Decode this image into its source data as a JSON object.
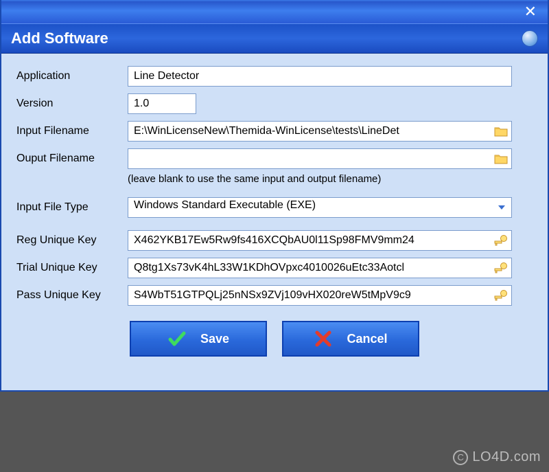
{
  "window": {
    "title": "Add Software"
  },
  "form": {
    "application": {
      "label": "Application",
      "value": "Line Detector"
    },
    "version": {
      "label": "Version",
      "value": "1.0"
    },
    "input_filename": {
      "label": "Input Filename",
      "value": "E:\\WinLicenseNew\\Themida-WinLicense\\tests\\LineDet"
    },
    "output_filename": {
      "label": "Ouput Filename",
      "value": "",
      "hint": "(leave blank to use the same input and output filename)"
    },
    "input_file_type": {
      "label": "Input File Type",
      "value": "Windows Standard Executable (EXE)"
    },
    "reg_key": {
      "label": "Reg Unique Key",
      "value": "X462YKB17Ew5Rw9fs416XCQbAU0l11Sp98FMV9mm24"
    },
    "trial_key": {
      "label": "Trial Unique Key",
      "value": "Q8tg1Xs73vK4hL33W1KDhOVpxc4010026uEtc33Aotcl"
    },
    "pass_key": {
      "label": "Pass Unique Key",
      "value": "S4WbT51GTPQLj25nNSx9ZVj109vHX020reW5tMpV9c9"
    }
  },
  "buttons": {
    "save": "Save",
    "cancel": "Cancel"
  },
  "watermark": "LO4D.com"
}
